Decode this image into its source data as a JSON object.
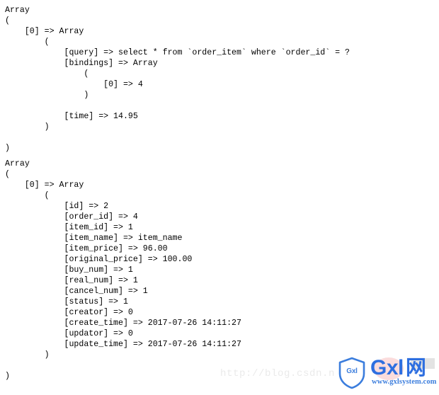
{
  "page": {
    "kind": "php-print-r-output",
    "background_color": "#ffffff",
    "text_color": "#000000"
  },
  "dump": {
    "blocks": [
      {
        "name": "query-log-array",
        "text": "Array\n(\n    [0] => Array\n        (\n            [query] => select * from `order_item` where `order_id` = ?\n            [bindings] => Array\n                (\n                    [0] => 4\n                )\n\n            [time] => 14.95\n        )\n\n)\n"
      },
      {
        "name": "order-item-rows-array",
        "text": "Array\n(\n    [0] => Array\n        (\n            [id] => 2\n            [order_id] => 4\n            [item_id] => 1\n            [item_name] => item_name\n            [item_price] => 96.00\n            [original_price] => 100.00\n            [buy_num] => 1\n            [real_num] => 1\n            [cancel_num] => 1\n            [status] => 1\n            [creator] => 0\n            [create_time] => 2017-07-26 14:11:27\n            [updator] => 0\n            [update_time] => 2017-07-26 14:11:27\n        )\n\n)"
      }
    ],
    "query_log": {
      "index": "[0]",
      "query": "select * from `order_item` where `order_id` = ?",
      "bindings": [
        "4"
      ],
      "time": "14.95"
    },
    "order_item_row": {
      "index": "[0]",
      "fields": [
        {
          "key": "id",
          "value": "2"
        },
        {
          "key": "order_id",
          "value": "4"
        },
        {
          "key": "item_id",
          "value": "1"
        },
        {
          "key": "item_name",
          "value": "item_name"
        },
        {
          "key": "item_price",
          "value": "96.00"
        },
        {
          "key": "original_price",
          "value": "100.00"
        },
        {
          "key": "buy_num",
          "value": "1"
        },
        {
          "key": "real_num",
          "value": "1"
        },
        {
          "key": "cancel_num",
          "value": "1"
        },
        {
          "key": "status",
          "value": "1"
        },
        {
          "key": "creator",
          "value": "0"
        },
        {
          "key": "create_time",
          "value": "2017-07-26 14:11:27"
        },
        {
          "key": "updator",
          "value": "0"
        },
        {
          "key": "update_time",
          "value": "2017-07-26 14:11:27"
        }
      ]
    }
  },
  "watermark": {
    "url_text": "http://blog.csdn.n",
    "url_color": "#eaeaea",
    "shield_label": "Gxl",
    "brand_latin": "Gxl",
    "brand_cjk": "网",
    "site": "www.gxlsystem.com",
    "brand_color": "#2e6fe0",
    "shield_color": "#3b7ddd"
  }
}
